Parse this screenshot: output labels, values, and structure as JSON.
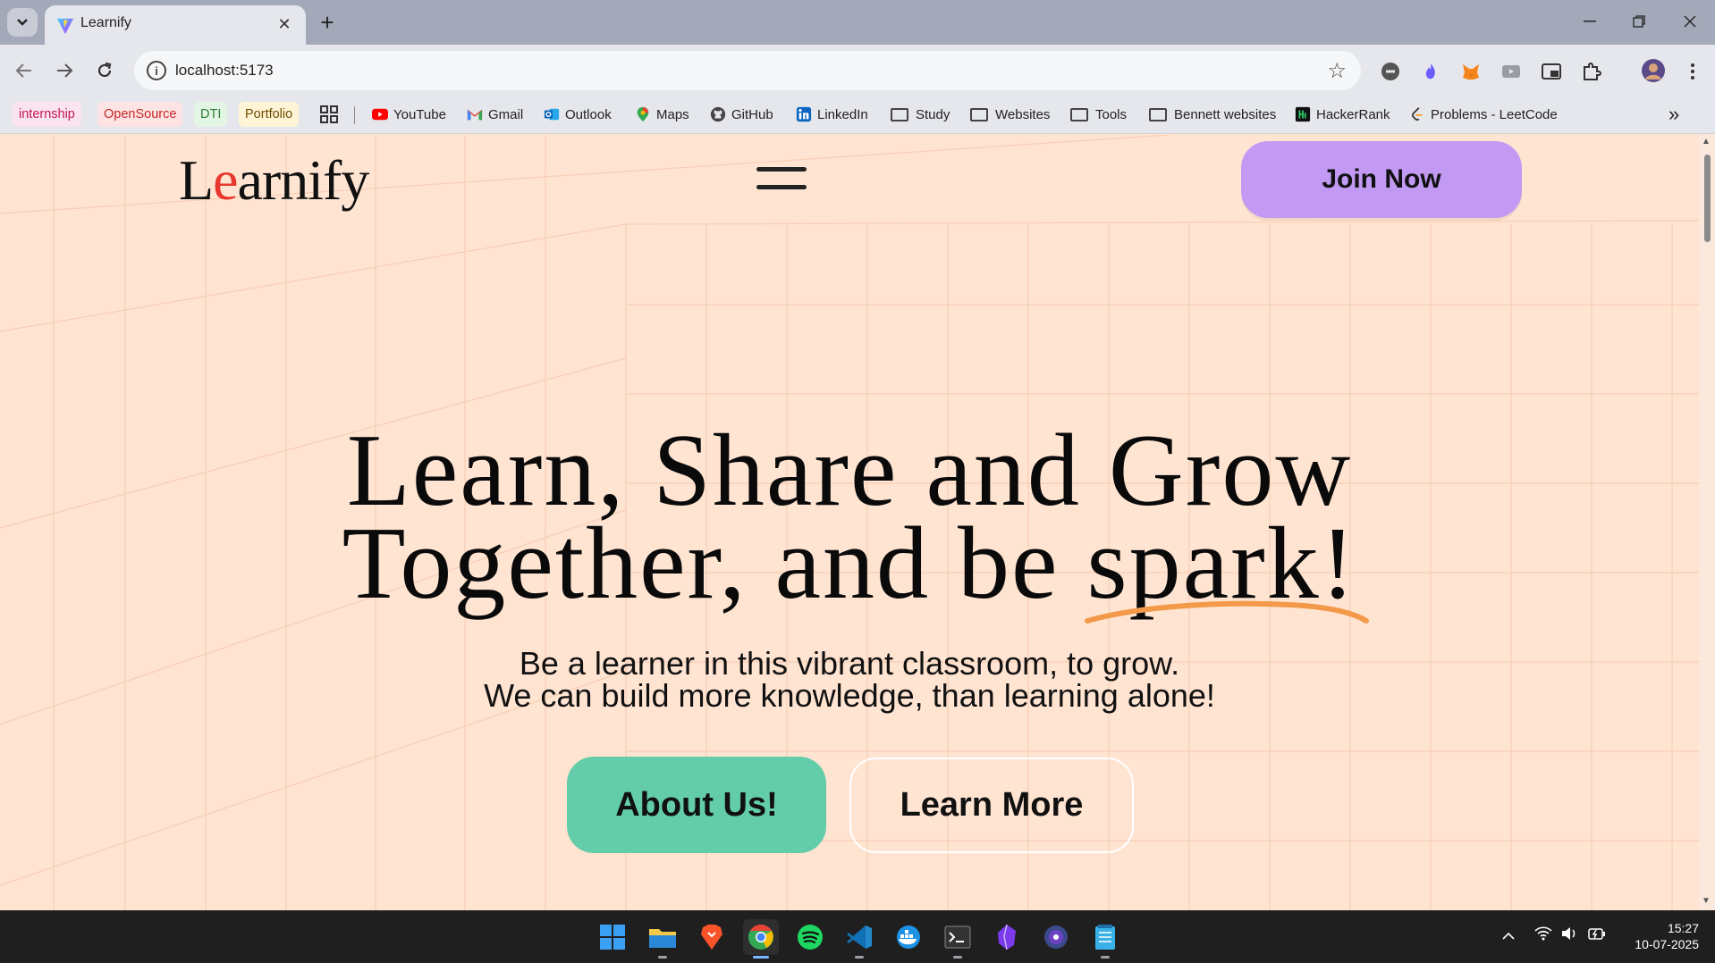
{
  "browser": {
    "tab_title": "Learnify",
    "tab_close": "✕",
    "new_tab": "+",
    "url": "localhost:5173"
  },
  "bookmarks": {
    "chips": [
      {
        "label": "internship",
        "color": "#c2185b",
        "bg": "#fbe4ef"
      },
      {
        "label": "OpenSource",
        "color": "#c62828",
        "bg": "#fde3e3"
      },
      {
        "label": "DTI",
        "color": "#2e7d32",
        "bg": "#e3f6e5"
      },
      {
        "label": "Portfolio",
        "color": "#6d4c00",
        "bg": "#fff5d6"
      }
    ],
    "links": [
      {
        "label": "YouTube",
        "icon": "youtube-icon"
      },
      {
        "label": "Gmail",
        "icon": "gmail-icon"
      },
      {
        "label": "Outlook",
        "icon": "outlook-icon"
      },
      {
        "label": "Maps",
        "icon": "maps-icon"
      },
      {
        "label": "GitHub",
        "icon": "github-icon"
      },
      {
        "label": "LinkedIn",
        "icon": "linkedin-icon"
      }
    ],
    "folders": [
      "Study",
      "Websites",
      "Tools",
      "Bennett websites"
    ],
    "extra_links": [
      {
        "label": "HackerRank",
        "icon": "hackerrank-icon"
      },
      {
        "label": "Problems - LeetCode",
        "icon": "leetcode-icon"
      }
    ],
    "overflow": "»"
  },
  "site": {
    "logo_first": "L",
    "logo_accent": "e",
    "logo_rest": "arnify",
    "join_button": "Join Now",
    "hero_line1": "Learn, Share and Grow",
    "hero_line2_prefix": "Together, and be ",
    "hero_highlight": "spark!",
    "subtitle_line1": "Be a learner in this vibrant classroom, to grow.",
    "subtitle_line2": "We can build more knowledge, than learning alone!",
    "about_button": "About Us!",
    "learn_button": "Learn More"
  },
  "colors": {
    "page_bg": "#ffe4d2",
    "join_bg": "#c29af4",
    "about_bg": "#63cda9",
    "logo_accent": "#e8372d",
    "underline": "#f39a4a"
  },
  "taskbar": {
    "apps": [
      "windows-start-icon",
      "file-explorer-icon",
      "brave-icon",
      "chrome-icon",
      "spotify-icon",
      "vscode-icon",
      "docker-icon",
      "terminal-icon",
      "obsidian-icon",
      "github-desktop-icon",
      "notepad-icon"
    ],
    "time": "15:27",
    "date": "10-07-2025"
  }
}
